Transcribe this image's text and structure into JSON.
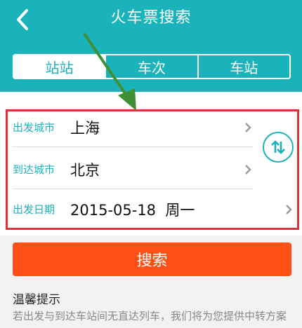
{
  "header": {
    "title": "火车票搜索",
    "back_icon": "chevron-left-icon",
    "background_color": "#1ab3bc"
  },
  "tabs": [
    {
      "label": "站站",
      "active": true
    },
    {
      "label": "车次",
      "active": false
    },
    {
      "label": "车站",
      "active": false
    }
  ],
  "form": {
    "departure": {
      "label": "出发城市",
      "value": "上海"
    },
    "arrival": {
      "label": "到达城市",
      "value": "北京"
    },
    "date": {
      "label": "出发日期",
      "value": "2015-05-18  周一"
    },
    "swap_icon": "swap-vertical-icon",
    "chevron_icon": "chevron-right-icon"
  },
  "search_button": {
    "label": "搜索",
    "color": "#ff5018"
  },
  "tips": {
    "title": "温馨提示",
    "text": "若出发与到达车站间无直达列车，我们将为您提供中转方案"
  },
  "annotation": {
    "highlight_color": "#e0303a",
    "arrow_color": "#3f8f34"
  }
}
